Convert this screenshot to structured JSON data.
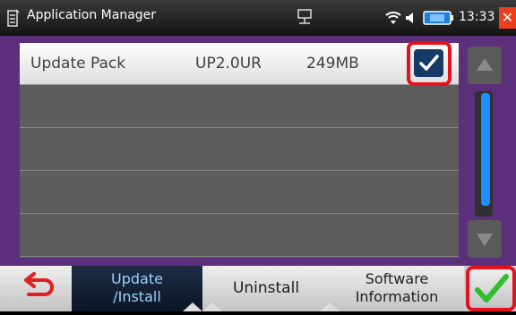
{
  "statusbar": {
    "title": "Application Manager",
    "time": "13:33"
  },
  "list": {
    "rows": [
      {
        "name": "Update Pack",
        "version": "UP2.0UR",
        "size": "249MB",
        "checked": true
      }
    ]
  },
  "bottom_tabs": {
    "update_install": {
      "line1": "Update",
      "line2": "/Install"
    },
    "uninstall": "Uninstall",
    "software_information": {
      "line1": "Software",
      "line2": "Information"
    }
  },
  "colors": {
    "selected_tab": "#0b1625",
    "highlight": "#e8101c",
    "accent_blue": "#1f8dff"
  }
}
